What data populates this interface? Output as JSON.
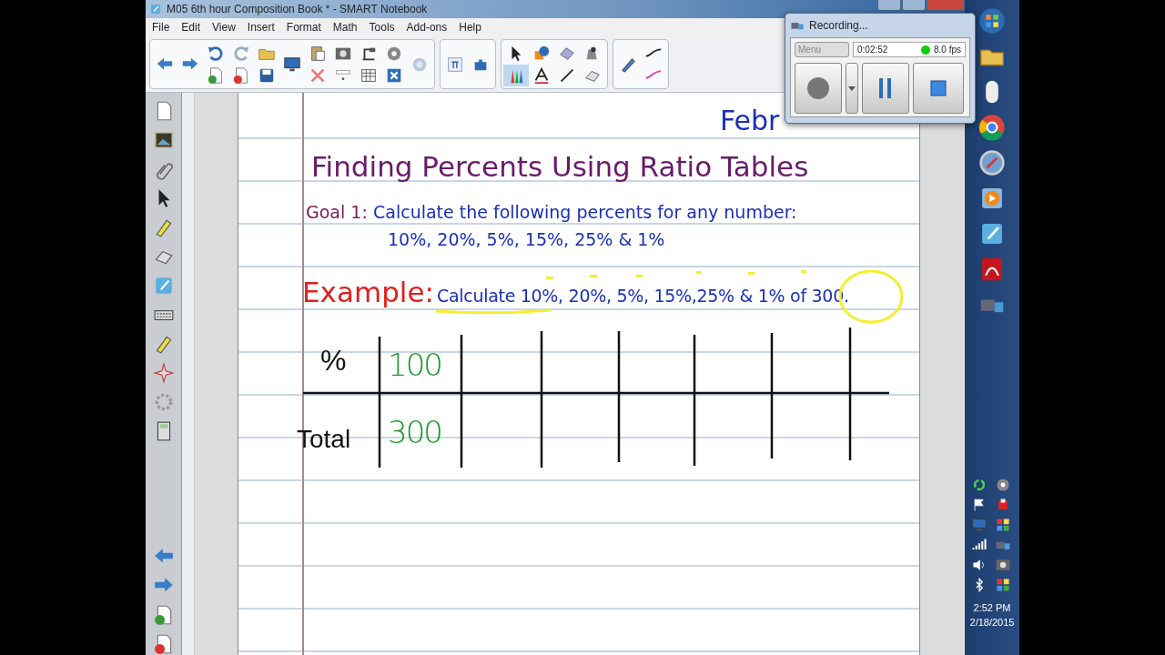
{
  "window": {
    "title": "M05 6th hour Composition Book * - SMART Notebook"
  },
  "menu": [
    "File",
    "Edit",
    "View",
    "Insert",
    "Format",
    "Math",
    "Tools",
    "Add-ons",
    "Help"
  ],
  "page": {
    "date": "Febr",
    "title": "Finding Percents Using Ratio Tables",
    "goal_label": "Goal 1:",
    "goal_text": "Calculate the following percents for any number:",
    "goal_list": "10%, 20%, 5%, 15%, 25% & 1%",
    "example_label": "Example:",
    "example_text": "Calculate 10%, 20%, 5%, 15%,25% & 1% of 300.",
    "table": {
      "row_labels": [
        "%",
        "Total"
      ],
      "cells": [
        "100",
        "300"
      ]
    }
  },
  "recorder": {
    "title": "Recording...",
    "menu": "Menu",
    "time": "0:02:52",
    "fps": "8.0 fps"
  },
  "clock": {
    "time": "2:52 PM",
    "date": "2/18/2015"
  }
}
